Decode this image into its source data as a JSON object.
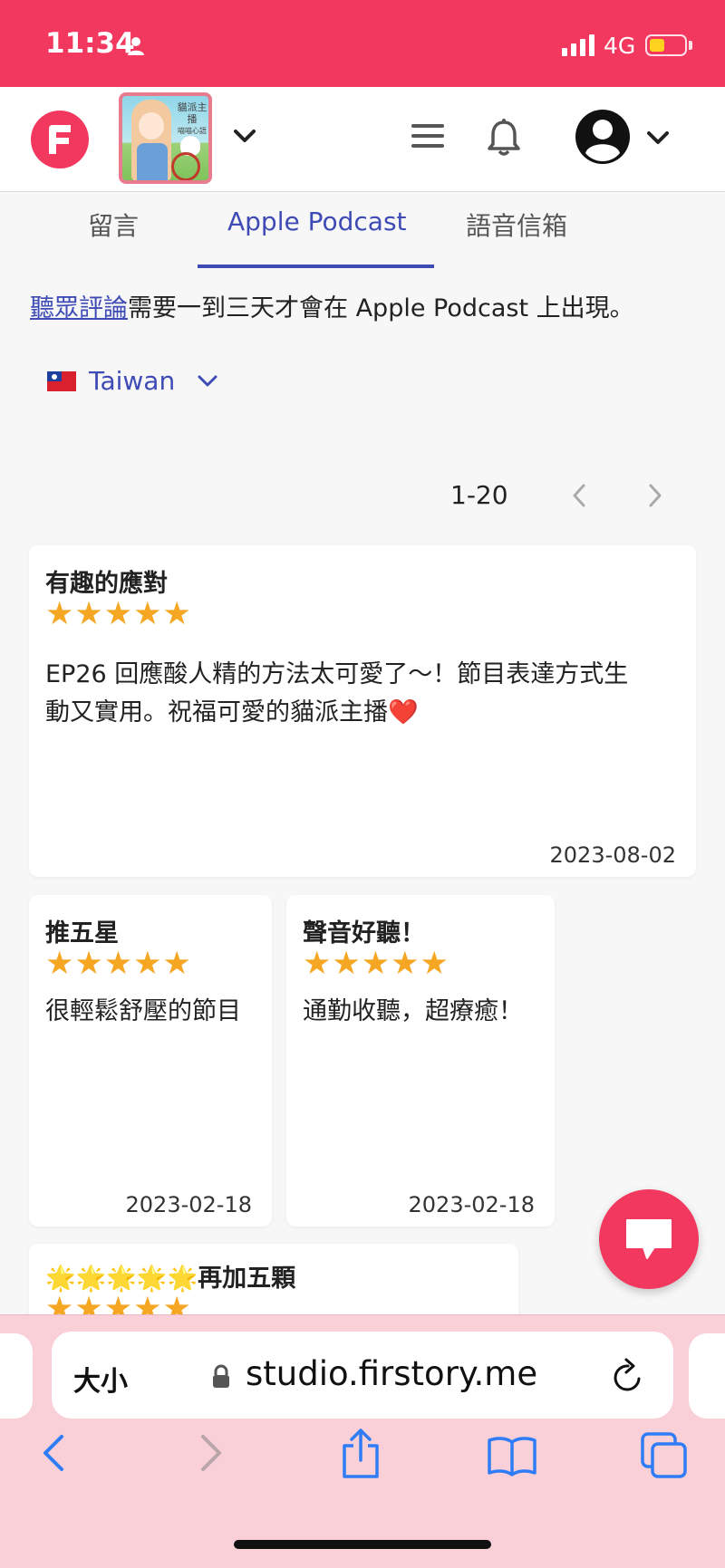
{
  "status_bar": {
    "time": "11:34",
    "network": "4G",
    "signal_bars": 4,
    "battery_level": 0.3
  },
  "header": {
    "cover_title": "貓派主播",
    "cover_subtitle": "喵喵心語"
  },
  "tabs": [
    {
      "label": "留言",
      "active": false
    },
    {
      "label": "Apple Podcast",
      "active": true
    },
    {
      "label": "語音信箱",
      "active": false
    }
  ],
  "notice": {
    "link_text": "聽眾評論",
    "text": "需要一到三天才會在 Apple Podcast 上出現。"
  },
  "country": {
    "label": "Taiwan",
    "flag": "taiwan-flag-icon"
  },
  "pagination": {
    "range": "1-20"
  },
  "reviews": [
    {
      "title": "有趣的應對",
      "rating": 5,
      "body_line1": "EP26 回應酸人精的方法太可愛了～！節目表達方式生",
      "body_line2": "動又實用。祝福可愛的貓派主播❤️",
      "date": "2023-08-02"
    },
    {
      "title": "推五星",
      "rating": 5,
      "body": "很輕鬆舒壓的節目",
      "date": "2023-02-18"
    },
    {
      "title": "聲音好聽！",
      "rating": 5,
      "body": "通勤收聽，超療癒！",
      "date": "2023-02-18"
    },
    {
      "title_prefix": "🌟🌟🌟🌟🌟",
      "title": "再加五顆",
      "rating": 5
    }
  ],
  "browser": {
    "text_size_label": "大小",
    "url": "studio.firstory.me"
  },
  "colors": {
    "brand": "#f3385f",
    "accent": "#3f4bb5",
    "star": "#f5a623",
    "browser_chrome": "#f9cfd8"
  }
}
